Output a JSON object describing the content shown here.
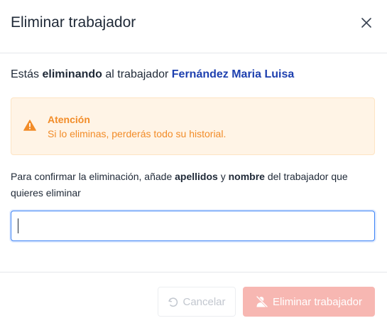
{
  "dialog": {
    "title": "Eliminar trabajador",
    "close_icon": "close-icon"
  },
  "intro": {
    "prefix": "Estás ",
    "bold": "eliminando",
    "middle": " al trabajador ",
    "worker_name": "Fernández Maria Luisa"
  },
  "alert": {
    "icon": "warning-icon",
    "title": "Atención",
    "message": "Si lo eliminas, perderás todo su historial.",
    "colors": {
      "background": "#fff4e6",
      "text": "#f28c28"
    }
  },
  "confirm": {
    "part1": "Para confirmar la eliminación, añade ",
    "bold1": "apellidos",
    "part2": " y ",
    "bold2": "nombre",
    "part3": " del trabajador que quieres eliminar"
  },
  "input": {
    "value": "",
    "placeholder": ""
  },
  "footer": {
    "cancel_label": "Cancelar",
    "cancel_icon": "undo-icon",
    "delete_label": "Eliminar trabajador",
    "delete_icon": "remove-user-icon",
    "colors": {
      "delete_bg": "#f7b7b2",
      "accent": "#1e40af"
    }
  }
}
